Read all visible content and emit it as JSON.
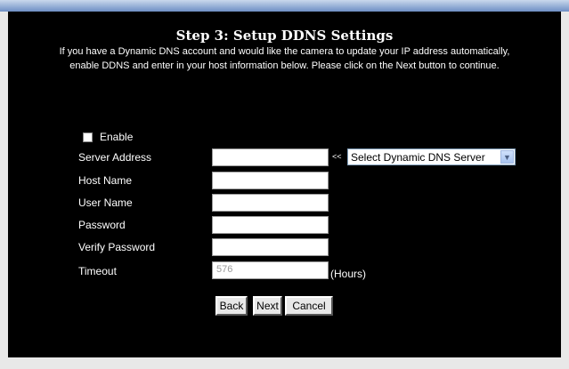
{
  "page": {
    "title": "Step 3: Setup DDNS Settings",
    "description_line1": "If you have a Dynamic DNS account and would like the camera to update your IP address automatically,",
    "description_line2": "enable DDNS and enter in your host information below. Please click on the Next button to continue."
  },
  "form": {
    "enable_label": "Enable",
    "enable_checked": false,
    "server_address_label": "Server Address",
    "server_address_value": "",
    "server_select_arrows": "<<",
    "server_select_value": "Select Dynamic DNS Server",
    "host_name_label": "Host Name",
    "host_name_value": "",
    "user_name_label": "User Name",
    "user_name_value": "",
    "password_label": "Password",
    "password_value": "",
    "verify_password_label": "Verify Password",
    "verify_password_value": "",
    "timeout_label": "Timeout",
    "timeout_value": "576",
    "timeout_unit": "(Hours)"
  },
  "buttons": {
    "back": "Back",
    "next": "Next",
    "cancel": "Cancel"
  },
  "icons": {
    "select_dropdown": "chevron-down-icon"
  },
  "colors": {
    "panel_background": "#000000",
    "text": "#ffffff",
    "top_bar": "#6d8fc4"
  }
}
